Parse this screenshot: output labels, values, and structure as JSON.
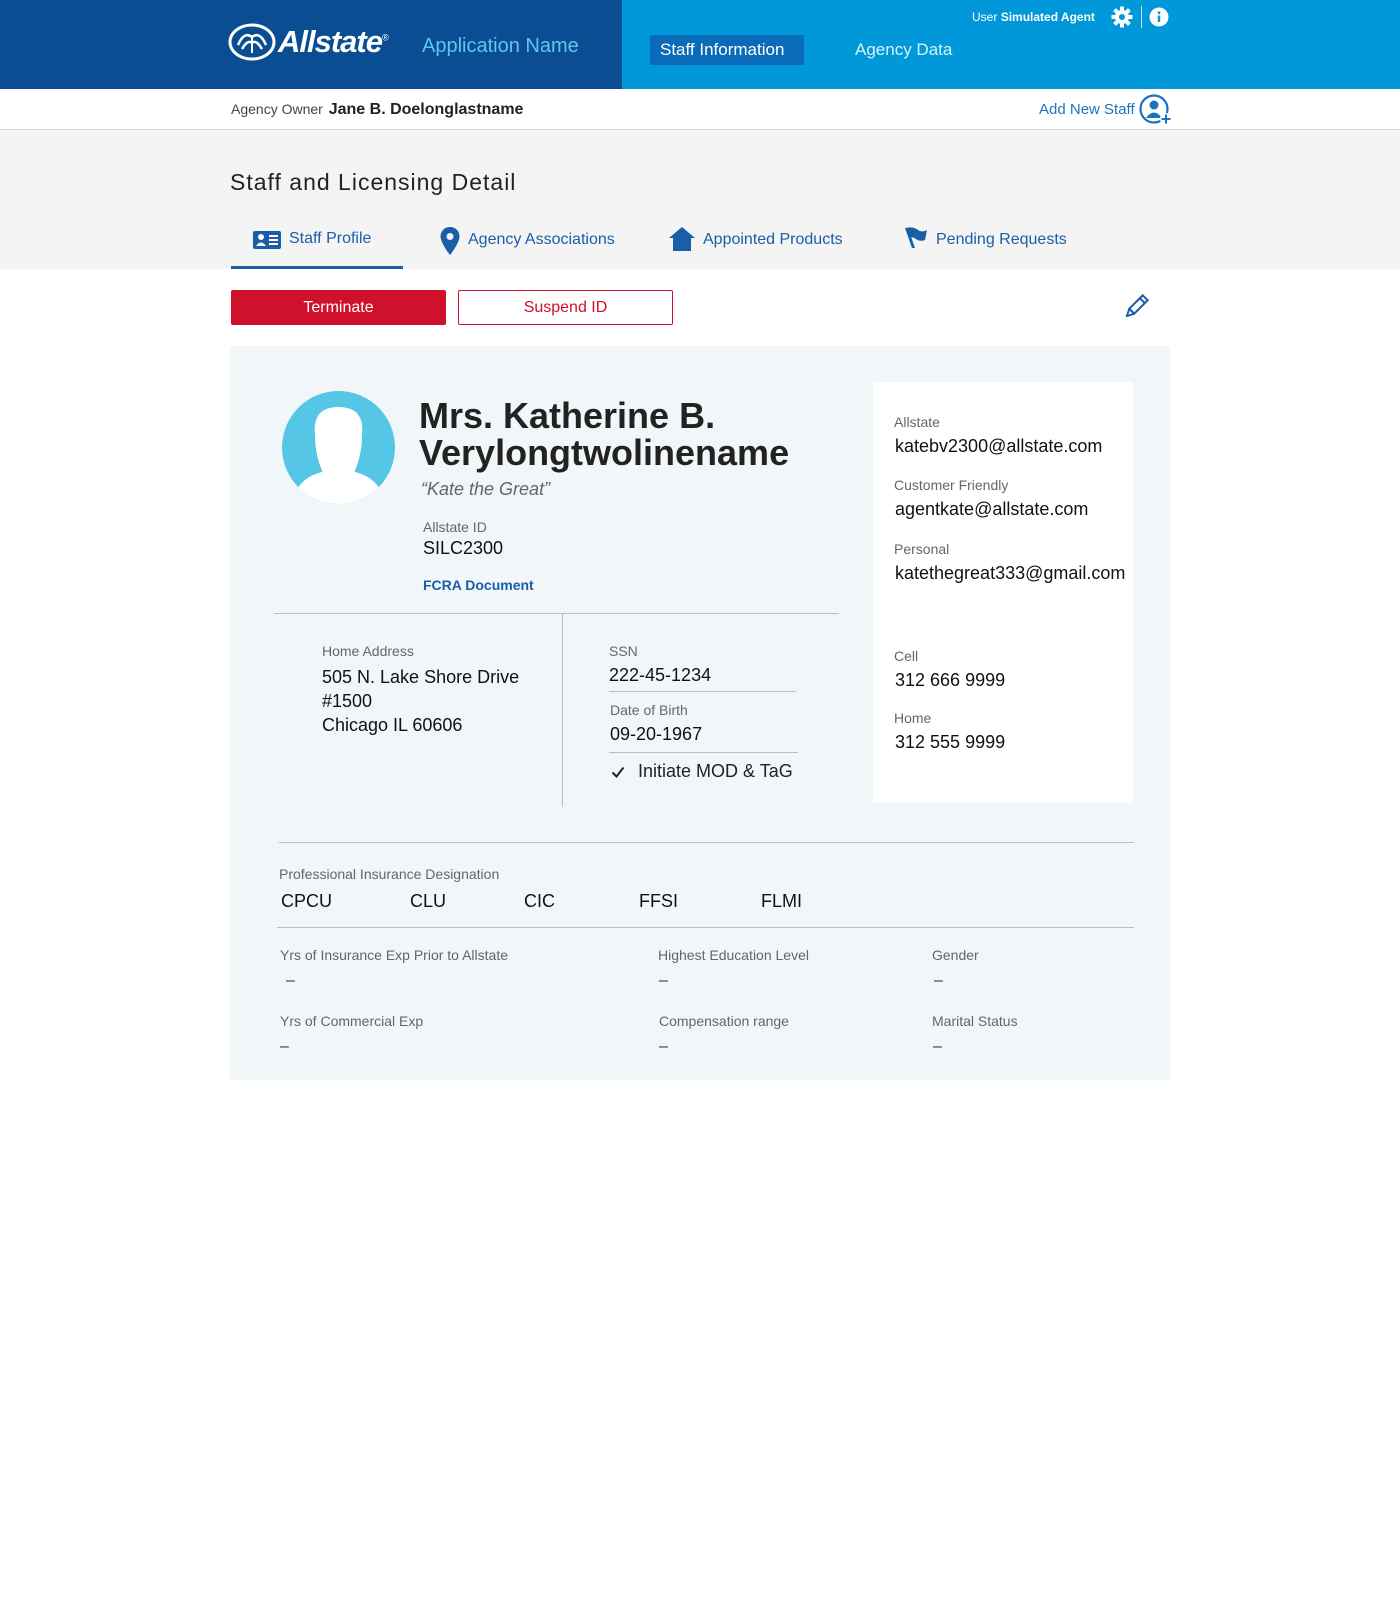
{
  "header": {
    "brand": "Allstate",
    "app_name": "Application Name",
    "nav": {
      "staff_info": "Staff Information",
      "agency_data": "Agency Data"
    },
    "user_prefix": "User",
    "user_name": "Simulated Agent"
  },
  "owner_bar": {
    "label": "Agency Owner",
    "name": "Jane B. Doelonglastname",
    "add_staff": "Add New Staff"
  },
  "detail": {
    "title": "Staff and Licensing Detail",
    "tabs": [
      {
        "label": "Staff Profile",
        "icon": "id-card-icon"
      },
      {
        "label": "Agency Associations",
        "icon": "map-pin-icon"
      },
      {
        "label": "Appointed Products",
        "icon": "house-icon"
      },
      {
        "label": "Pending Requests",
        "icon": "flag-icon"
      }
    ],
    "buttons": {
      "terminate": "Terminate",
      "suspend": "Suspend ID"
    }
  },
  "profile": {
    "name_line1": "Mrs. Katherine B.",
    "name_line2": "Verylongtwolinename",
    "nickname": "“Kate the Great”",
    "allstate_id_label": "Allstate ID",
    "allstate_id": "SILC2300",
    "fcra": "FCRA Document",
    "home_address_label": "Home Address",
    "address_line1": "505 N. Lake Shore Drive",
    "address_line2": "#1500",
    "address_line3": "Chicago IL 60606",
    "ssn_label": "SSN",
    "ssn": "222-45-1234",
    "dob_label": "Date of Birth",
    "dob": "09-20-1967",
    "initiate_mod": "Initiate MOD & TaG"
  },
  "contact": {
    "allstate_label": "Allstate",
    "allstate_email": "katebv2300@allstate.com",
    "friendly_label": "Customer Friendly",
    "friendly_email": "agentkate@allstate.com",
    "personal_label": "Personal",
    "personal_email": "katethegreat333@gmail.com",
    "cell_label": "Cell",
    "cell": "312 666 9999",
    "home_label": "Home",
    "home": "312 555 9999"
  },
  "designations": {
    "label": "Professional Insurance Designation",
    "items": [
      "CPCU",
      "CLU",
      "CIC",
      "FFSI",
      "FLMI"
    ]
  },
  "experience": {
    "ins_exp_label": "Yrs of Insurance Exp Prior to Allstate",
    "ins_exp": "–",
    "education_label": "Highest Education Level",
    "education": "–",
    "gender_label": "Gender",
    "gender": "–",
    "commercial_label": "Yrs of Commercial Exp",
    "commercial": "–",
    "compensation_label": "Compensation range",
    "compensation": "–",
    "marital_label": "Marital Status",
    "marital": "–"
  },
  "colors": {
    "brand_dark": "#0a4d92",
    "brand_light": "#0098d8",
    "accent_red": "#d0112b",
    "link_blue": "#1a5ea8",
    "avatar_blue": "#56c6e6"
  }
}
